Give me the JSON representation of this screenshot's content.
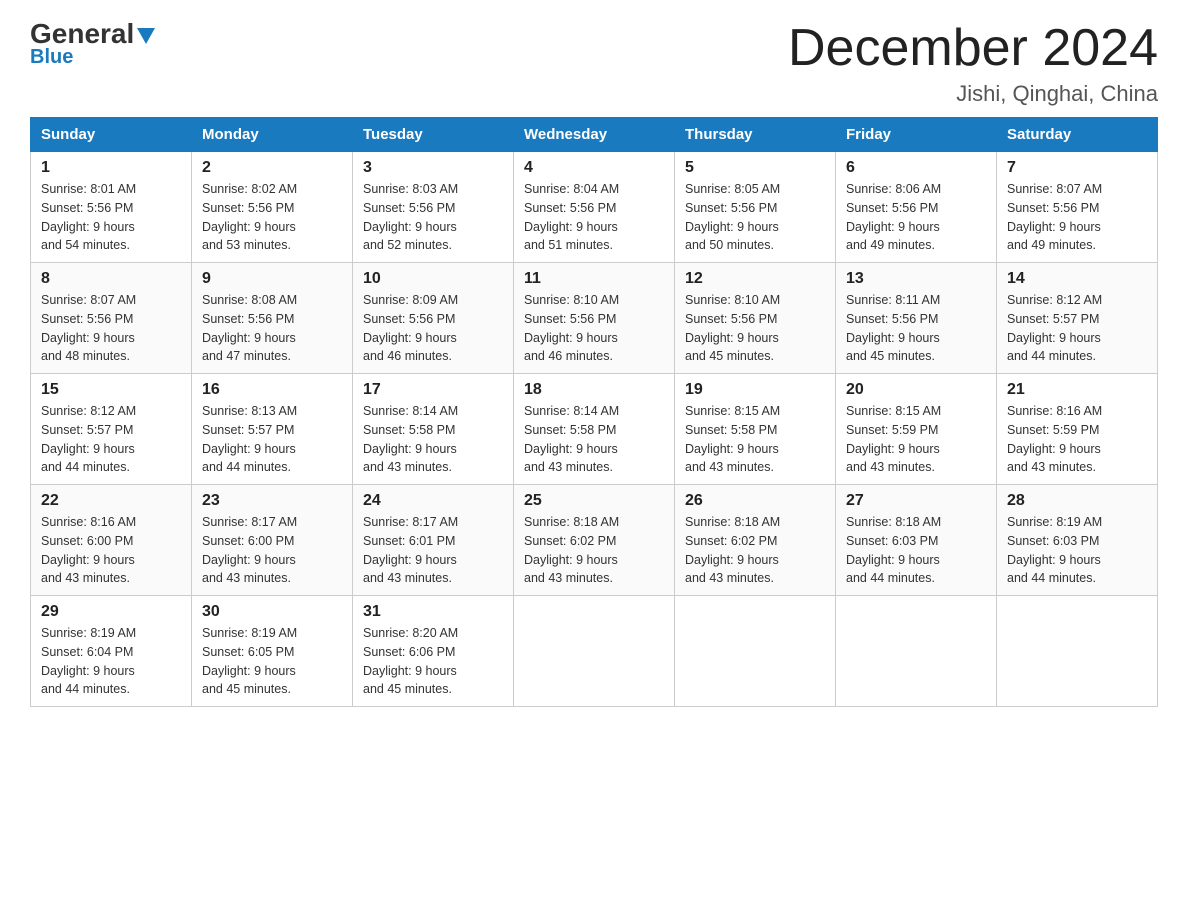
{
  "header": {
    "logo_general": "General",
    "logo_blue": "Blue",
    "month_title": "December 2024",
    "location": "Jishi, Qinghai, China"
  },
  "days_of_week": [
    "Sunday",
    "Monday",
    "Tuesday",
    "Wednesday",
    "Thursday",
    "Friday",
    "Saturday"
  ],
  "weeks": [
    [
      {
        "num": "1",
        "sunrise": "8:01 AM",
        "sunset": "5:56 PM",
        "daylight": "9 hours and 54 minutes."
      },
      {
        "num": "2",
        "sunrise": "8:02 AM",
        "sunset": "5:56 PM",
        "daylight": "9 hours and 53 minutes."
      },
      {
        "num": "3",
        "sunrise": "8:03 AM",
        "sunset": "5:56 PM",
        "daylight": "9 hours and 52 minutes."
      },
      {
        "num": "4",
        "sunrise": "8:04 AM",
        "sunset": "5:56 PM",
        "daylight": "9 hours and 51 minutes."
      },
      {
        "num": "5",
        "sunrise": "8:05 AM",
        "sunset": "5:56 PM",
        "daylight": "9 hours and 50 minutes."
      },
      {
        "num": "6",
        "sunrise": "8:06 AM",
        "sunset": "5:56 PM",
        "daylight": "9 hours and 49 minutes."
      },
      {
        "num": "7",
        "sunrise": "8:07 AM",
        "sunset": "5:56 PM",
        "daylight": "9 hours and 49 minutes."
      }
    ],
    [
      {
        "num": "8",
        "sunrise": "8:07 AM",
        "sunset": "5:56 PM",
        "daylight": "9 hours and 48 minutes."
      },
      {
        "num": "9",
        "sunrise": "8:08 AM",
        "sunset": "5:56 PM",
        "daylight": "9 hours and 47 minutes."
      },
      {
        "num": "10",
        "sunrise": "8:09 AM",
        "sunset": "5:56 PM",
        "daylight": "9 hours and 46 minutes."
      },
      {
        "num": "11",
        "sunrise": "8:10 AM",
        "sunset": "5:56 PM",
        "daylight": "9 hours and 46 minutes."
      },
      {
        "num": "12",
        "sunrise": "8:10 AM",
        "sunset": "5:56 PM",
        "daylight": "9 hours and 45 minutes."
      },
      {
        "num": "13",
        "sunrise": "8:11 AM",
        "sunset": "5:56 PM",
        "daylight": "9 hours and 45 minutes."
      },
      {
        "num": "14",
        "sunrise": "8:12 AM",
        "sunset": "5:57 PM",
        "daylight": "9 hours and 44 minutes."
      }
    ],
    [
      {
        "num": "15",
        "sunrise": "8:12 AM",
        "sunset": "5:57 PM",
        "daylight": "9 hours and 44 minutes."
      },
      {
        "num": "16",
        "sunrise": "8:13 AM",
        "sunset": "5:57 PM",
        "daylight": "9 hours and 44 minutes."
      },
      {
        "num": "17",
        "sunrise": "8:14 AM",
        "sunset": "5:58 PM",
        "daylight": "9 hours and 43 minutes."
      },
      {
        "num": "18",
        "sunrise": "8:14 AM",
        "sunset": "5:58 PM",
        "daylight": "9 hours and 43 minutes."
      },
      {
        "num": "19",
        "sunrise": "8:15 AM",
        "sunset": "5:58 PM",
        "daylight": "9 hours and 43 minutes."
      },
      {
        "num": "20",
        "sunrise": "8:15 AM",
        "sunset": "5:59 PM",
        "daylight": "9 hours and 43 minutes."
      },
      {
        "num": "21",
        "sunrise": "8:16 AM",
        "sunset": "5:59 PM",
        "daylight": "9 hours and 43 minutes."
      }
    ],
    [
      {
        "num": "22",
        "sunrise": "8:16 AM",
        "sunset": "6:00 PM",
        "daylight": "9 hours and 43 minutes."
      },
      {
        "num": "23",
        "sunrise": "8:17 AM",
        "sunset": "6:00 PM",
        "daylight": "9 hours and 43 minutes."
      },
      {
        "num": "24",
        "sunrise": "8:17 AM",
        "sunset": "6:01 PM",
        "daylight": "9 hours and 43 minutes."
      },
      {
        "num": "25",
        "sunrise": "8:18 AM",
        "sunset": "6:02 PM",
        "daylight": "9 hours and 43 minutes."
      },
      {
        "num": "26",
        "sunrise": "8:18 AM",
        "sunset": "6:02 PM",
        "daylight": "9 hours and 43 minutes."
      },
      {
        "num": "27",
        "sunrise": "8:18 AM",
        "sunset": "6:03 PM",
        "daylight": "9 hours and 44 minutes."
      },
      {
        "num": "28",
        "sunrise": "8:19 AM",
        "sunset": "6:03 PM",
        "daylight": "9 hours and 44 minutes."
      }
    ],
    [
      {
        "num": "29",
        "sunrise": "8:19 AM",
        "sunset": "6:04 PM",
        "daylight": "9 hours and 44 minutes."
      },
      {
        "num": "30",
        "sunrise": "8:19 AM",
        "sunset": "6:05 PM",
        "daylight": "9 hours and 45 minutes."
      },
      {
        "num": "31",
        "sunrise": "8:20 AM",
        "sunset": "6:06 PM",
        "daylight": "9 hours and 45 minutes."
      },
      null,
      null,
      null,
      null
    ]
  ]
}
